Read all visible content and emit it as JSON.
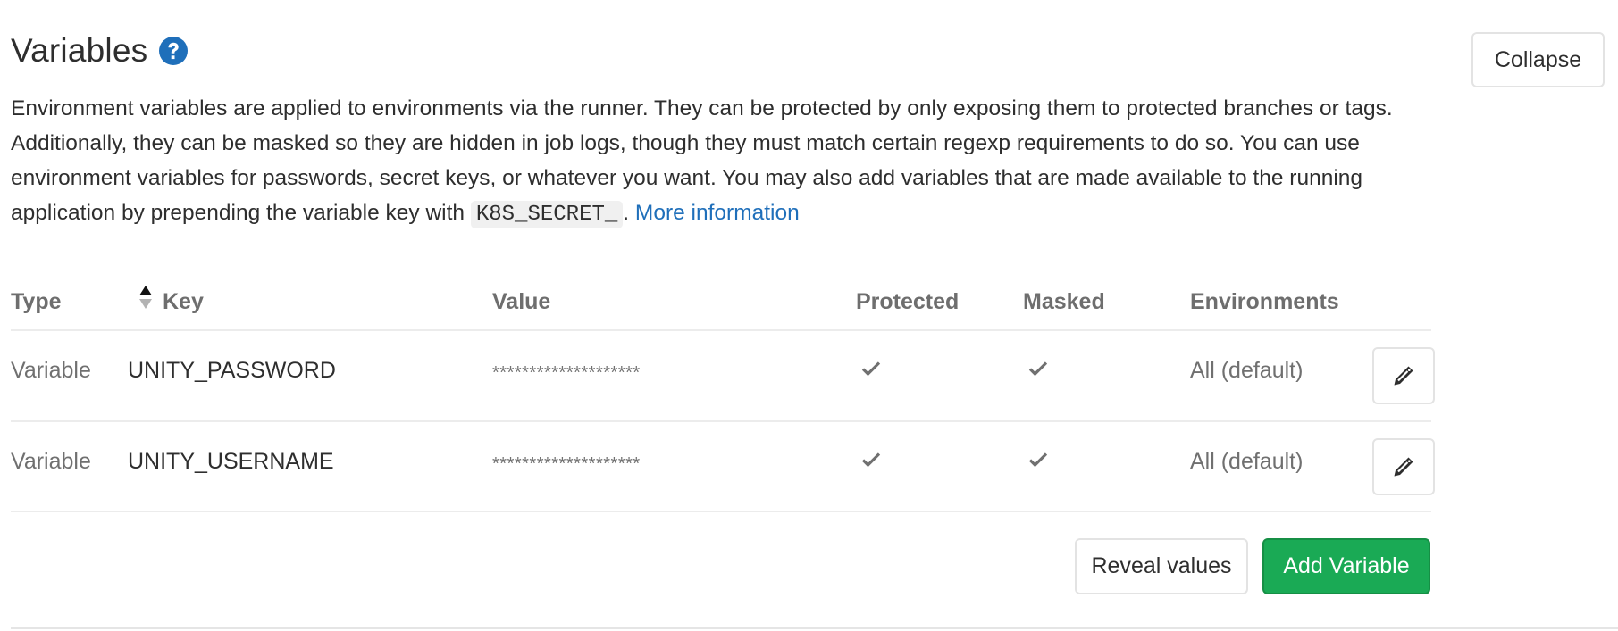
{
  "section": {
    "title": "Variables",
    "help_icon": "question-circle-icon",
    "collapse_label": "Collapse",
    "description_text": "Environment variables are applied to environments via the runner. They can be protected by only exposing them to protected branches or tags. Additionally, they can be masked so they are hidden in job logs, though they must match certain regexp requirements to do so. You can use environment variables for passwords, secret keys, or whatever you want. You may also add variables that are made available to the running application by prepending the variable key with",
    "code_snippet": "K8S_SECRET_",
    "after_code": ".",
    "more_info_link": "More information"
  },
  "table": {
    "headers": {
      "type": "Type",
      "key": "Key",
      "value": "Value",
      "protected": "Protected",
      "masked": "Masked",
      "environments": "Environments"
    },
    "sort_icon": "sort-ascending-icon",
    "rows": [
      {
        "type": "Variable",
        "key": "UNITY_PASSWORD",
        "value": "********************",
        "protected": true,
        "masked": true,
        "environment": "All (default)"
      },
      {
        "type": "Variable",
        "key": "UNITY_USERNAME",
        "value": "********************",
        "protected": true,
        "masked": true,
        "environment": "All (default)"
      }
    ]
  },
  "actions": {
    "reveal_label": "Reveal values",
    "add_label": "Add Variable"
  },
  "colors": {
    "primary_green": "#1aaa55",
    "link_blue": "#1f6fba",
    "help_icon_blue": "#1f6fba"
  }
}
